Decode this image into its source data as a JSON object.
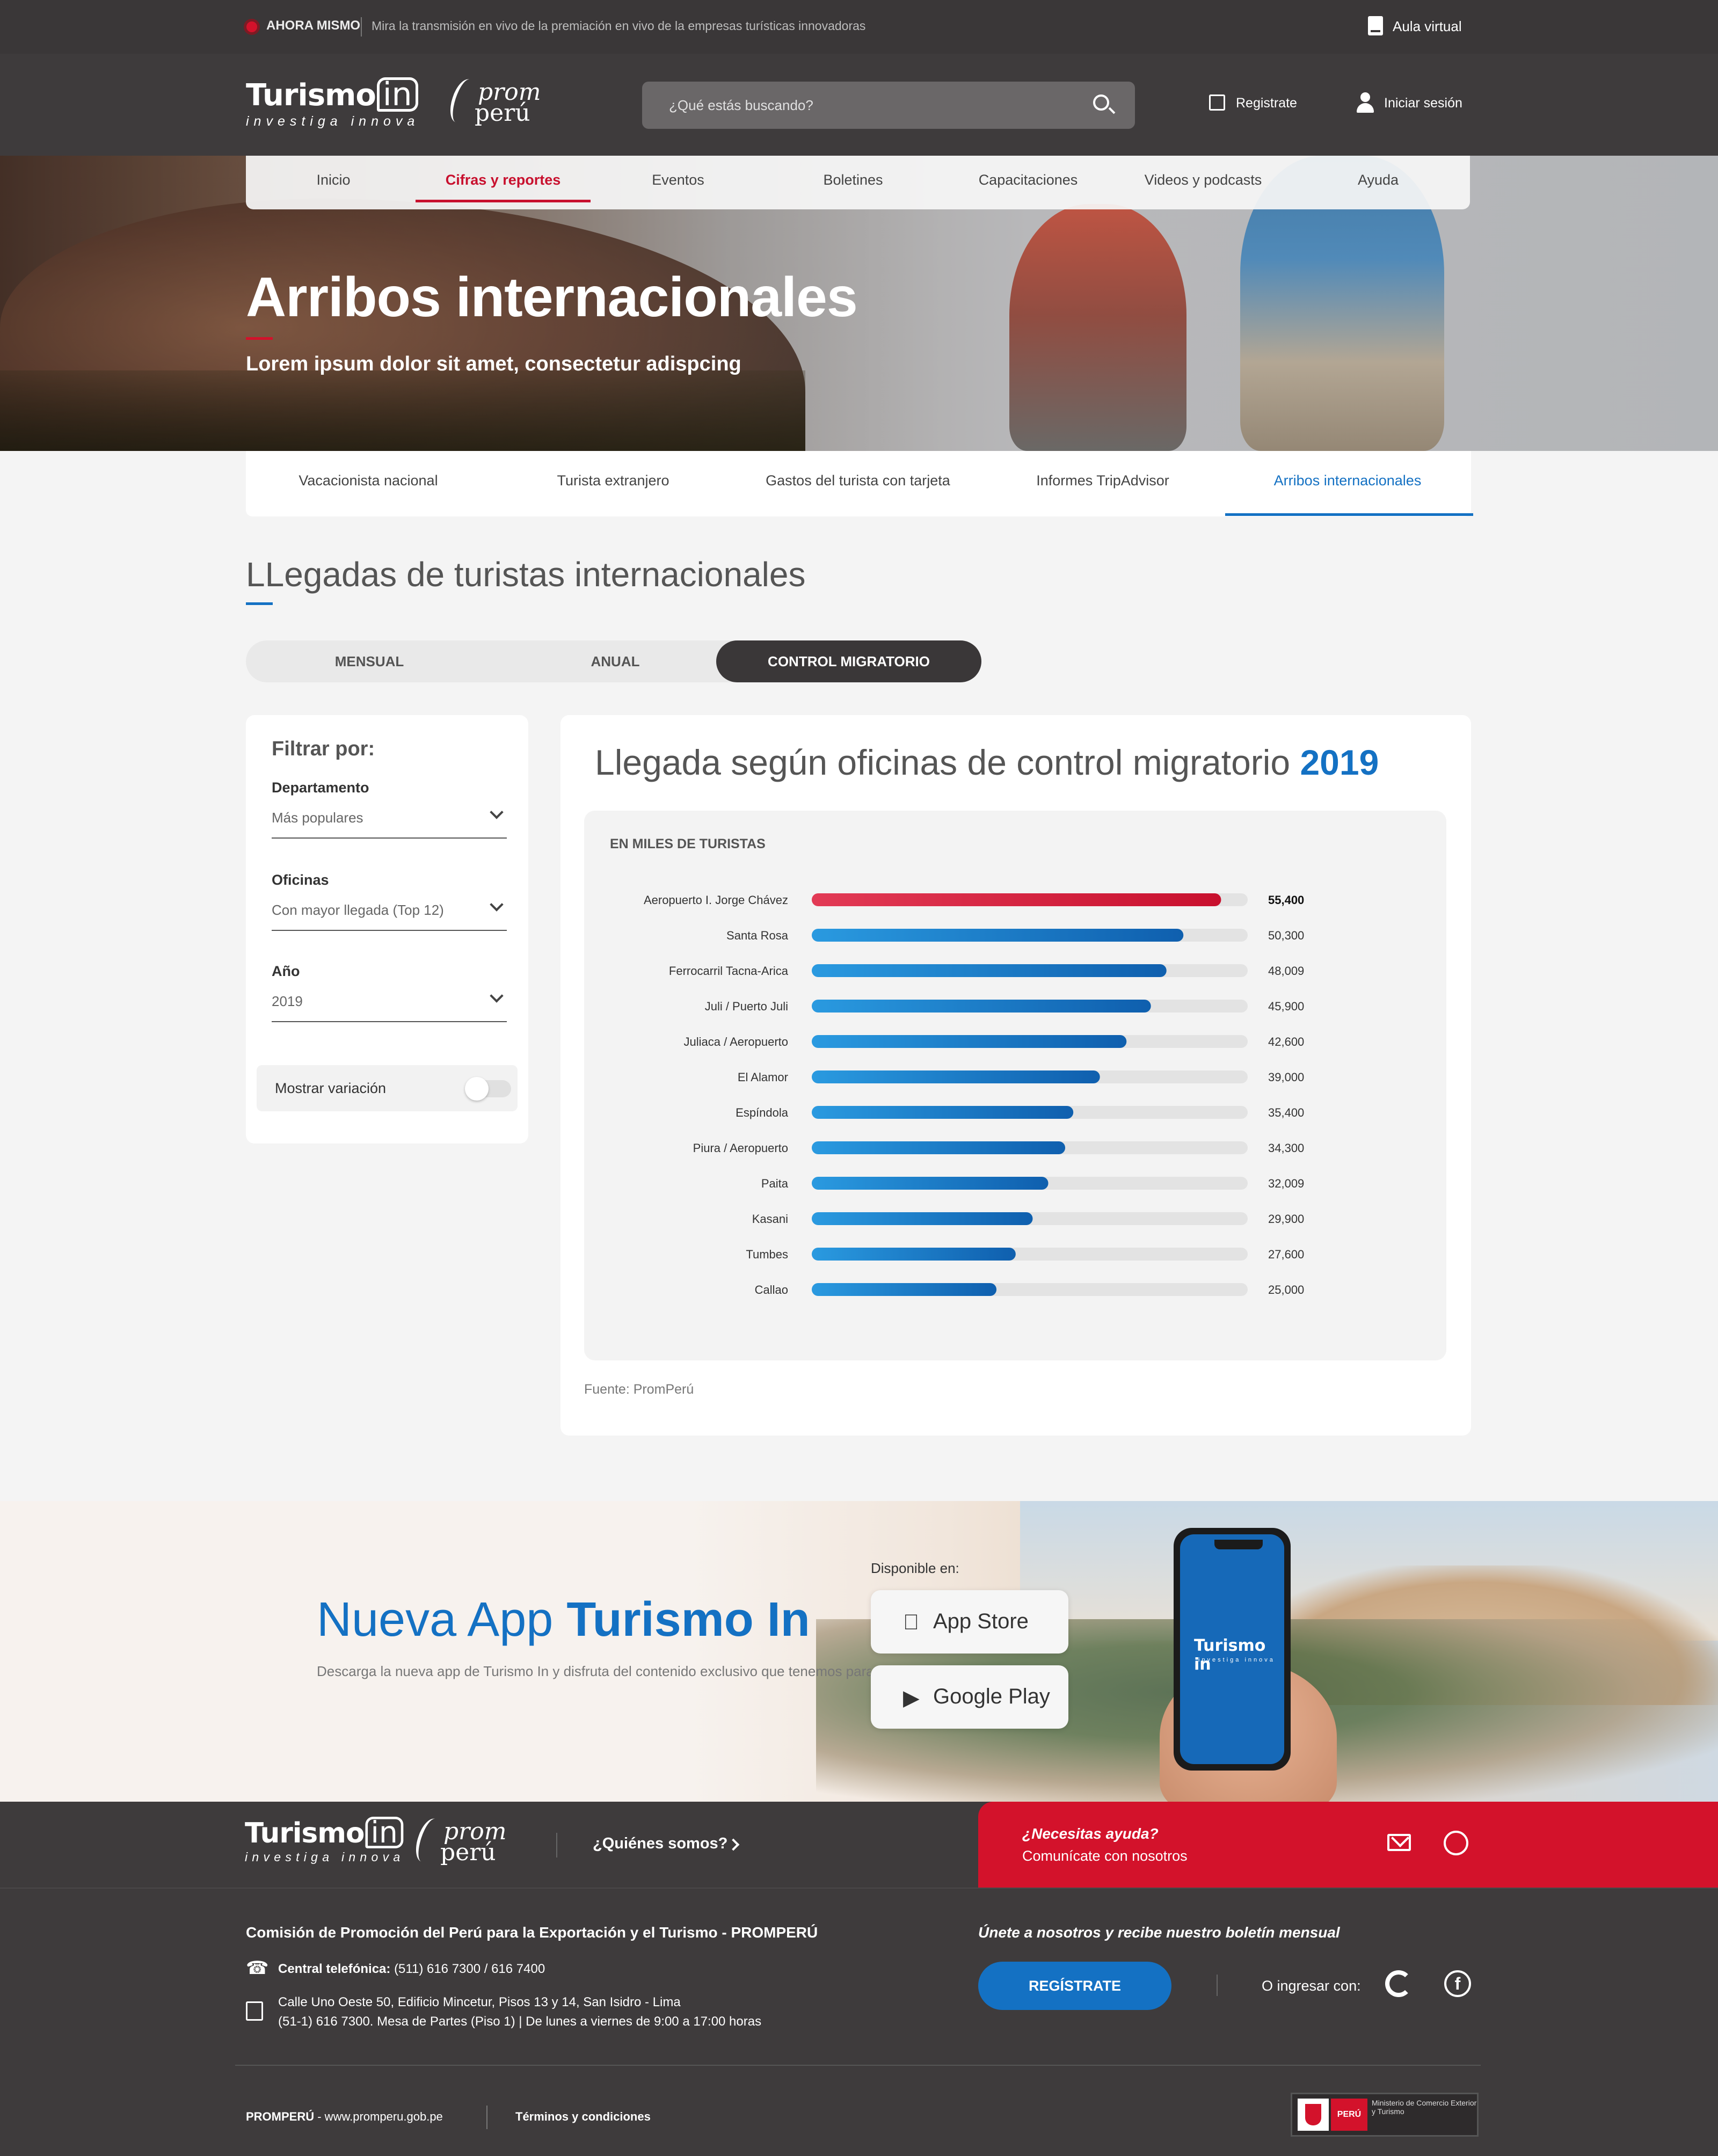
{
  "topbar": {
    "live_label": "AHORA MISMO",
    "live_text": "Mira la transmisión en vivo de la premiación en vivo de la empresas turísticas innovadoras",
    "aula": "Aula virtual"
  },
  "brand": {
    "logo_word": "Turismo",
    "logo_in": "in",
    "logo_sub": "investiga innova",
    "promp_a": "prom",
    "promp_b": "perú"
  },
  "header": {
    "search_placeholder": "¿Qué estás buscando?",
    "register": "Registrate",
    "login": "Iniciar sesión"
  },
  "nav": {
    "items": [
      {
        "label": "Inicio",
        "active": false
      },
      {
        "label": "Cifras y reportes",
        "active": true
      },
      {
        "label": "Eventos",
        "active": false
      },
      {
        "label": "Boletines",
        "active": false
      },
      {
        "label": "Capacitaciones",
        "active": false
      },
      {
        "label": "Videos y podcasts",
        "active": false
      },
      {
        "label": "Ayuda",
        "active": false
      }
    ]
  },
  "hero": {
    "title": "Arribos internacionales",
    "subtitle": "Lorem ipsum dolor sit amet, consectetur adispcing"
  },
  "subtabs": [
    {
      "label": "Vacacionista nacional",
      "active": false
    },
    {
      "label": "Turista extranjero",
      "active": false
    },
    {
      "label": "Gastos del turista con tarjeta",
      "active": false
    },
    {
      "label": "Informes TripAdvisor",
      "active": false
    },
    {
      "label": "Arribos internacionales",
      "active": true
    }
  ],
  "section_title": "LLegadas de turistas internacionales",
  "segments": [
    {
      "label": "MENSUAL",
      "active": false
    },
    {
      "label": "ANUAL",
      "active": false
    },
    {
      "label": "CONTROL MIGRATORIO",
      "active": true
    }
  ],
  "filters": {
    "title": "Filtrar por:",
    "department_label": "Departamento",
    "department_value": "Más populares",
    "offices_label": "Oficinas",
    "offices_value": "Con mayor llegada (Top 12)",
    "year_label": "Año",
    "year_value": "2019",
    "variation_label": "Mostrar variación",
    "variation_on": false
  },
  "chart_card": {
    "title": "Llegada según oficinas de control migratorio",
    "year": "2019",
    "unit": "EN MILES DE TURISTAS",
    "source": "Fuente: PromPerú"
  },
  "colors": {
    "accent_red": "#d3122b",
    "accent_blue": "#1471c3",
    "bar_highlight": "#d41f3c",
    "bar_default": "#1a74c4",
    "dark": "#3e3b3c"
  },
  "chart_data": {
    "type": "bar",
    "orientation": "horizontal",
    "categories": [
      "Aeropuerto I. Jorge Chávez",
      "Santa Rosa",
      "Ferrocarril Tacna-Arica",
      "Juli / Puerto Juli",
      "Juliaca / Aeropuerto",
      "El Alamor",
      "Espíndola",
      "Piura / Aeropuerto",
      "Paita",
      "Kasani",
      "Tumbes",
      "Callao"
    ],
    "values": [
      55400,
      50300,
      48009,
      45900,
      42600,
      39000,
      35400,
      34300,
      32009,
      29900,
      27600,
      25000
    ],
    "value_labels": [
      "55,400",
      "50,300",
      "48,009",
      "45,900",
      "42,600",
      "39,000",
      "35,400",
      "34,300",
      "32,009",
      "29,900",
      "27,600",
      "25,000"
    ],
    "highlight_index": 0,
    "xlim": [
      0,
      59000
    ],
    "grid": false,
    "legend": "none"
  },
  "promo": {
    "title_a": "Nueva App",
    "title_b": "Turismo In",
    "desc": "Descarga la nueva app de Turismo In y disfruta del contenido exclusivo que tenemos para ti",
    "available": "Disponible en:",
    "appstore": "App Store",
    "googleplay": "Google Play",
    "phone_logo": "Turismo in",
    "phone_sub": "investiga innova"
  },
  "footer": {
    "who": "¿Quiénes somos?",
    "help_q": "¿Necesitas ayuda?",
    "help_c": "Comunícate con nosotros",
    "org": "Comisión de Promoción del Perú para la Exportación y el Turismo - PROMPERÚ",
    "tel_label": "Central telefónica:",
    "tel": "(511) 616 7300 / 616 7400",
    "addr1": "Calle Uno Oeste 50, Edificio Mincetur, Pisos 13 y 14, San Isidro - Lima",
    "addr2": "(51-1) 616 7300. Mesa de Partes (Piso 1) | De lunes a viernes de 9:00 a 17:00 horas",
    "newsletter": "Únete a nosotros y recibe nuestro boletín mensual",
    "register_btn": "REGÍSTRATE",
    "or_login": "O ingresar con:",
    "copyright_b": "PROMPERÚ",
    "copyright": " - www.promperu.gob.pe",
    "terms": "Términos y condiciones",
    "gov_pe": "PERÚ",
    "gov_min": "Ministerio de Comercio Exterior y Turismo"
  }
}
